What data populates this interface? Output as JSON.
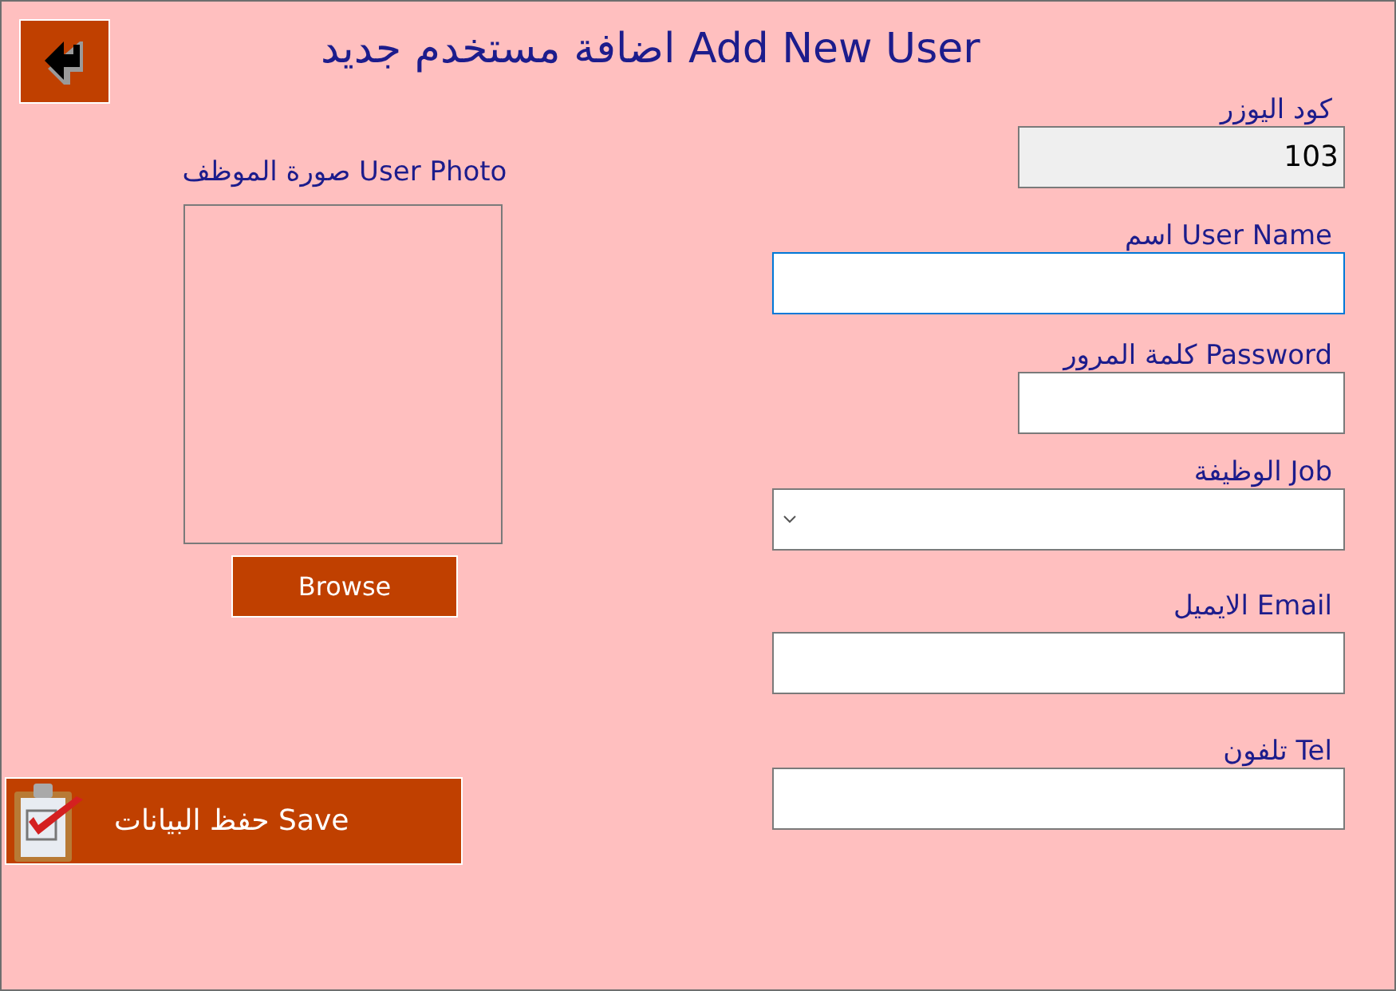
{
  "title": "اضافة مستخدم جديد Add New User",
  "photo": {
    "label": "صورة الموظف User Photo",
    "browse_button": "Browse"
  },
  "save_button": "حفظ البيانات Save",
  "fields": [
    {
      "kind": "readonly",
      "label": "كود اليوزر",
      "value": "103",
      "focused": false
    },
    {
      "kind": "text",
      "label": "اسم User Name",
      "focused": true
    },
    {
      "kind": "password",
      "label": "كلمة المرور  Password",
      "focused": false
    },
    {
      "kind": "select",
      "label": "الوظيفة Job",
      "focused": false
    },
    {
      "kind": "text",
      "label": "الايميل Email",
      "focused": false
    },
    {
      "kind": "text",
      "label": "تلفون Tel",
      "focused": false
    }
  ]
}
